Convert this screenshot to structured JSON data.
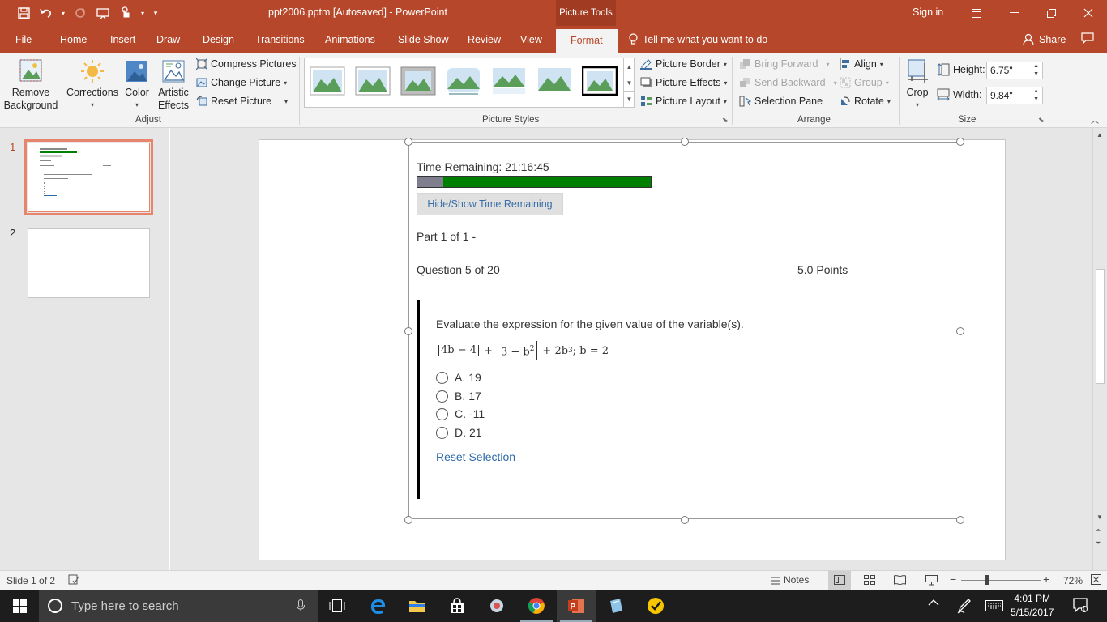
{
  "title_bar": {
    "document_title": "ppt2006.pptm [Autosaved]  -  PowerPoint",
    "contextual_tab_group": "Picture Tools",
    "sign_in": "Sign in"
  },
  "tabs": [
    "File",
    "Home",
    "Insert",
    "Draw",
    "Design",
    "Transitions",
    "Animations",
    "Slide Show",
    "Review",
    "View",
    "Format"
  ],
  "active_tab": "Format",
  "tell_me": "Tell me what you want to do",
  "share": "Share",
  "ribbon": {
    "adjust": {
      "remove_background_1": "Remove",
      "remove_background_2": "Background",
      "corrections": "Corrections",
      "color": "Color",
      "artistic_1": "Artistic",
      "artistic_2": "Effects",
      "compress": "Compress Pictures",
      "change": "Change Picture",
      "reset": "Reset Picture",
      "group_label": "Adjust"
    },
    "styles": {
      "picture_border": "Picture Border",
      "picture_effects": "Picture Effects",
      "picture_layout": "Picture Layout",
      "group_label": "Picture Styles"
    },
    "arrange": {
      "bring_forward": "Bring Forward",
      "send_backward": "Send Backward",
      "selection_pane": "Selection Pane",
      "align": "Align",
      "group": "Group",
      "rotate": "Rotate",
      "group_label": "Arrange"
    },
    "size": {
      "crop": "Crop",
      "height_label": "Height:",
      "height_value": "6.75\"",
      "width_label": "Width:",
      "width_value": "9.84\"",
      "group_label": "Size"
    }
  },
  "slides": [
    {
      "number": "1"
    },
    {
      "number": "2"
    }
  ],
  "slide_content": {
    "time_remaining": "Time Remaining: 21:16:45",
    "time_used_fraction": 0.11,
    "hide_show_button": "Hide/Show Time Remaining",
    "part": "Part 1 of 1 -",
    "question": "Question 5 of 20",
    "points": "5.0 Points",
    "prompt": "Evaluate the expression for the given value of the variable(s).",
    "expression": {
      "abs1_inner": "4b − 4",
      "plus1": "+",
      "abs2_inner": "3 − b",
      "exp2": "2",
      "plus2": "+ 2b",
      "exp3": "3",
      "given": "; b = 2"
    },
    "options": [
      {
        "letter": "A.",
        "value": "19"
      },
      {
        "letter": "B.",
        "value": "17"
      },
      {
        "letter": "C.",
        "value": "-11"
      },
      {
        "letter": "D.",
        "value": "21"
      }
    ],
    "reset_selection": "Reset Selection"
  },
  "status_bar": {
    "slide_indicator": "Slide 1 of 2",
    "notes": "Notes",
    "zoom": "72%"
  },
  "taskbar": {
    "search_placeholder": "Type here to search",
    "time": "4:01 PM",
    "date": "5/15/2017"
  },
  "colors": {
    "accent": "#b7472a",
    "progress_remaining": "#008000",
    "progress_used": "#7e7e8e",
    "link": "#2d6aa8"
  }
}
